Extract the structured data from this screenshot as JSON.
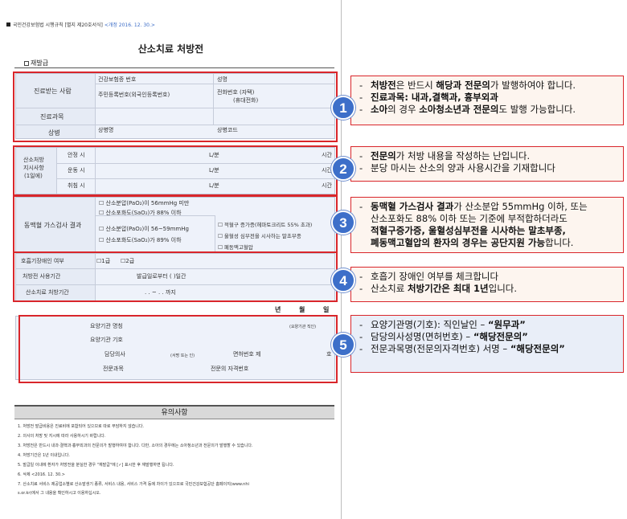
{
  "form": {
    "header_rule": "국민건강보험법 시행규칙 [별지 제20호서식]",
    "header_revision": "<개정 2016. 12. 30.>",
    "title": "산소치료 처방전",
    "reissue": "재발급",
    "patient": {
      "label": "진료받는 사람",
      "insurance_no": "건강보험증 번호",
      "name": "성명",
      "resident_no": "주민등록번호(외국인등록번호)",
      "phone_line1": "전화번호 (자택)",
      "phone_line2": "(휴대전화)",
      "dept_label": "진료과목",
      "disease_label": "상병",
      "disease_name": "상병명",
      "disease_code": "상병코드"
    },
    "prescription": {
      "label_line1": "산소처방",
      "label_line2": "지시사항",
      "label_line3": "(1일에)",
      "rows": [
        {
          "label": "안정 시",
          "unit": "L/분",
          "time": "시간"
        },
        {
          "label": "운동 시",
          "unit": "L/분",
          "time": "시간"
        },
        {
          "label": "취침 시",
          "unit": "L/분",
          "time": "시간"
        }
      ]
    },
    "abg": {
      "label": "동맥혈 가스검사 결과",
      "opt1": "산소분압(PaO₂)이 56mmHg 미만",
      "opt2": "산소포화도(SaO₂)가 88% 이하",
      "opt3": "산소분압(PaO₂)이 56~59mmHg",
      "opt4": "산소포화도(SaO₂)가 89% 이하",
      "sub1": "적혈구 증가증(헤마토크리트 55% 초과)",
      "sub2": "울혈성 심부전을 시사하는 말초부종",
      "sub3": "폐동맥고혈압"
    },
    "disability": {
      "label": "호흡기장애인 여부",
      "opt1": "1급",
      "opt2": "2급"
    },
    "period": {
      "label": "처방전 사용기간",
      "value": "발급일로부터 (          )일간"
    },
    "therapy": {
      "label": "산소치료 처방기간",
      "value": ".      .      ~      .      .      까지"
    },
    "date_year": "년",
    "date_month": "월",
    "date_day": "일",
    "institution": {
      "name": "요양기관 명칭",
      "seal": "(요양기관 직인)",
      "code": "요양기관 기호",
      "doctor": "담당의사",
      "doctor_sign": "(서명 또는 인)",
      "license": "면허번호  제",
      "license_suffix": "호",
      "dept": "전문과목",
      "qual": "전문의 자격번호"
    },
    "caution_title": "유의사항",
    "cautions": [
      "1. 처방전 발급비용은 진료비에 포함되어 있으므로 따로 부담하지 않습니다.",
      "2. 의사의 처방 및 지시에 따라 사용하시기 바랍니다.",
      "3. 처방전은 반드시 내과·결핵과·흉부외과의 전문의가 발행하여야 합니다. 다만, 소아의 경우에는 소아청소년과 전문의가 발행할 수 있습니다.",
      "4. 처방기간은 1년 이내입니다.",
      "5. 발급일 이내에 환자가 처방전을 분실한 경우 \"재발급\"에 [✓] 표시한 후 재발행하면 됩니다.",
      "6. 삭제 <2016. 12. 30.>",
      "7. 산소치료 서비스 제공업소별로 산소발생기 종류, 서비스 내용, 서비스 가격 등에 차이가 있으므로 국민건강보험공단 홈페이지(www.nhi",
      "   s.or.kr)에서 그 내용을 확인하시고 이용하십시오."
    ]
  },
  "notes": [
    {
      "number": "1",
      "lines": [
        {
          "parts": [
            {
              "t": "처방전",
              "b": true
            },
            {
              "t": "은 반드시 ",
              "b": false
            },
            {
              "t": "해당과 전문의",
              "b": true
            },
            {
              "t": "가 발행하여야 합니다.",
              "b": false
            }
          ]
        },
        {
          "parts": [
            {
              "t": "진료과목: 내과,결핵과, 흉부외과",
              "b": true
            }
          ]
        },
        {
          "parts": [
            {
              "t": "소아",
              "b": true
            },
            {
              "t": "의 경우 ",
              "b": false
            },
            {
              "t": "소아청소년과 전문의",
              "b": true
            },
            {
              "t": "도 발행 가능합니다.",
              "b": false
            }
          ]
        }
      ]
    },
    {
      "number": "2",
      "lines": [
        {
          "parts": [
            {
              "t": "전문의",
              "b": true
            },
            {
              "t": "가 처방 내용을 작성하는 난입니다.",
              "b": false
            }
          ]
        },
        {
          "parts": [
            {
              "t": "분당 마시는 산소의 양과 사용시간을 기재합니다",
              "b": false
            }
          ]
        }
      ]
    },
    {
      "number": "3",
      "lines": [
        {
          "parts": [
            {
              "t": "동맥혈 가스검사 결과",
              "b": true
            },
            {
              "t": "가 산소분압 55mmHg  이하, 또는",
              "b": false
            }
          ]
        },
        {
          "cont": true,
          "parts": [
            {
              "t": "산소포화도 88% 이하 또는 기준에 부적합하더라도",
              "b": false
            }
          ]
        },
        {
          "cont": true,
          "parts": [
            {
              "t": "적혈구증가증, 울혈성심부전을 시사하는 말초부종,",
              "b": true
            }
          ]
        },
        {
          "cont": true,
          "parts": [
            {
              "t": "폐동맥고혈압의 환자의 경우는 공단지원 가능",
              "b": true
            },
            {
              "t": "합니다.",
              "b": false
            }
          ]
        }
      ]
    },
    {
      "number": "4",
      "lines": [
        {
          "parts": [
            {
              "t": "호흡기 장애인 여부를 체크합니다",
              "b": false
            }
          ]
        },
        {
          "parts": [
            {
              "t": "산소치료 ",
              "b": false
            },
            {
              "t": "처방기간은 최대 1년",
              "b": true
            },
            {
              "t": "입니다.",
              "b": false
            }
          ]
        }
      ]
    },
    {
      "number": "5",
      "lines": [
        {
          "parts": [
            {
              "t": "요양기관명(기호): 직인날인 – ",
              "b": false
            },
            {
              "t": "“원무과”",
              "b": true
            }
          ]
        },
        {
          "parts": [
            {
              "t": "담당의사성명(면허번호) – ",
              "b": false
            },
            {
              "t": "“해당전문의”",
              "b": true
            }
          ]
        },
        {
          "parts": [
            {
              "t": "전문과목명(전문의자격번호) 서명 – ",
              "b": false
            },
            {
              "t": "“해당전문의”",
              "b": true
            }
          ]
        }
      ]
    }
  ],
  "colors": {
    "highlight_border": "#d9262b",
    "badge": "#3d6fc9",
    "note_bg": "#fdf5ef",
    "note_bg_alt": "#e9eef8"
  }
}
